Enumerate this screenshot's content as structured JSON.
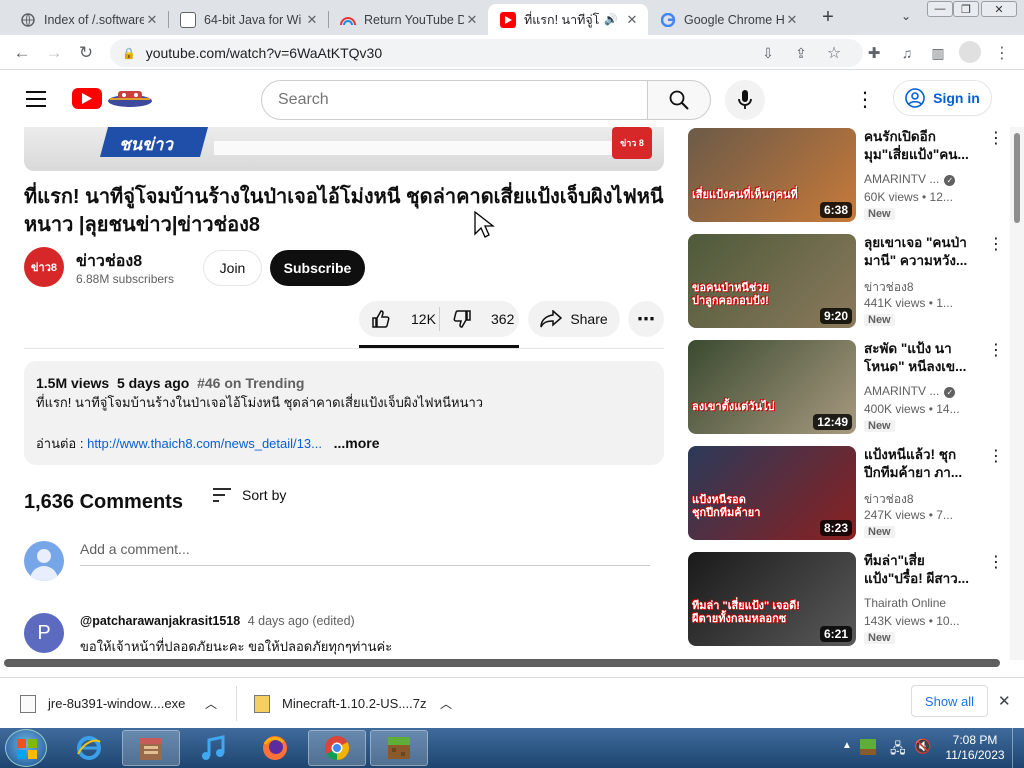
{
  "browser": {
    "tabs": [
      {
        "title": "Index of /.software",
        "icon": "folder-icon"
      },
      {
        "title": "64-bit Java for Wi",
        "icon": "page-icon"
      },
      {
        "title": "Return YouTube D",
        "icon": "rainbow-icon"
      },
      {
        "title": "ที่แรก! นาทีจู่โ",
        "icon": "youtube-icon",
        "active": true
      },
      {
        "title": "Google Chrome H",
        "icon": "google-icon"
      }
    ],
    "url": "youtube.com/watch?v=6WaAtKTQv30"
  },
  "youtube": {
    "search_placeholder": "Search",
    "signin_label": "Sign in",
    "thumb_badge": "ข่าว 8",
    "thumb_text": "ชนข่าว",
    "video": {
      "title": "ที่แรก! นาทีจู่โจมบ้านร้างในป่าเจอไอ้โม่งหนี ชุดล่าคาดเสี่ยแป้งเจ็บผิงไฟหนีหนาว |ลุยชนข่าว|ข่าวช่อง8",
      "channel": "ข่าวช่อง8",
      "channel_avatar_text": "ข่าว8",
      "subscribers": "6.88M subscribers",
      "join": "Join",
      "subscribe": "Subscribe",
      "likes": "12K",
      "dislikes": "362",
      "share": "Share"
    },
    "description": {
      "views": "1.5M views",
      "age": "5 days ago",
      "trending": "#46 on Trending",
      "line1": "ที่แรก! นาทีจู่โจมบ้านร้างในป่าเจอไอ้โม่งหนี ชุดล่าคาดเสี่ยแป้งเจ็บผิงไฟหนีหนาว",
      "read_more_prefix": "อ่านต่อ : ",
      "link": "http://www.thaich8.com/news_detail/13...",
      "more": "...more"
    },
    "comments": {
      "count_label": "1,636 Comments",
      "sort_label": "Sort by",
      "add_placeholder": "Add a comment...",
      "first": {
        "avatar_letter": "P",
        "author": "@patcharawanjakrasit1518",
        "age": "4 days ago (edited)",
        "text": "ขอให้เจ้าหน้าที่ปลอดภัยนะคะ ขอให้ปลอดภัยทุกๆท่านค่ะ"
      }
    },
    "recommendations": [
      {
        "title": "คนรักเปิดอีก\nมุม\"เสี่ยแป้ง\"คน...",
        "channel": "AMARINTV ...",
        "verified": true,
        "meta": "60K views • 12...",
        "duration": "6:38",
        "badge": "New",
        "thumb_caption": "เสี่ยแป้งคนที่เห็นกุคนที่",
        "colors": [
          "#6b5a48",
          "#c77a3a"
        ]
      },
      {
        "title": "ลุยเขาเจอ \"คนป่า\nมานี\" ความหวัง...",
        "channel": "ข่าวช่อง8",
        "verified": false,
        "meta": "441K views • 1...",
        "duration": "9:20",
        "badge": "New",
        "thumb_caption": "ขอคนป่าหนีช่วย\nปาลูกคอกอบปัง!",
        "colors": [
          "#4d5a3a",
          "#8c7a5c"
        ]
      },
      {
        "title": "สะพัด \"แป้ง นา\nโหนด\" หนีลงเข...",
        "channel": "AMARINTV ...",
        "verified": true,
        "meta": "400K views • 14...",
        "duration": "12:49",
        "badge": "New",
        "thumb_caption": "ลงเขาตั้งแต่วันไป",
        "colors": [
          "#3a4a30",
          "#a89a80"
        ]
      },
      {
        "title": "แป้งหนีแล้ว! ชุก\nปีกทีมค้ายา ภา...",
        "channel": "ข่าวช่อง8",
        "verified": false,
        "meta": "247K views • 7...",
        "duration": "8:23",
        "badge": "New",
        "thumb_caption": "แป้งหนีรอด\nชุกปีกทีมค้ายา",
        "colors": [
          "#2b3a5a",
          "#8a2020"
        ]
      },
      {
        "title": "ทีมล่า\"เสี่ย\nแป้ง\"ปรื๋อ! ผีสาว...",
        "channel": "Thairath Online",
        "verified": false,
        "meta": "143K views • 10...",
        "duration": "6:21",
        "badge": "New",
        "thumb_caption": "ทีมล่า \"เสี่ยแป้ง\" เจอดี!\nผีตายทั้งกลมหลอกซ",
        "colors": [
          "#1a1a1a",
          "#5a5a5a"
        ]
      }
    ]
  },
  "downloads": {
    "items": [
      "jre-8u391-window....exe",
      "Minecraft-1.10.2-US....7z"
    ],
    "show_all": "Show all"
  },
  "taskbar": {
    "time": "7:08 PM",
    "date": "11/16/2023"
  }
}
